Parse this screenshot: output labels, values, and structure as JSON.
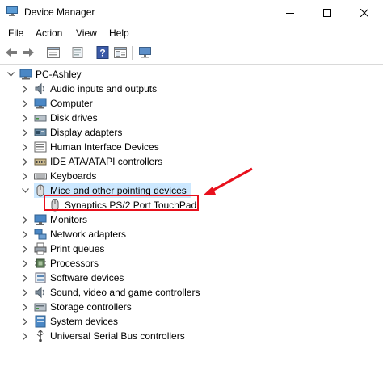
{
  "window": {
    "title": "Device Manager",
    "minimize_icon": "minimize-icon",
    "maximize_icon": "maximize-icon",
    "close_icon": "close-icon"
  },
  "menu": [
    "File",
    "Action",
    "View",
    "Help"
  ],
  "toolbar": {
    "buttons": [
      "back-arrow-icon",
      "forward-arrow-icon",
      "properties-icon",
      "update-driver-icon",
      "help-icon",
      "show-hidden-icon",
      "scan-hardware-icon"
    ]
  },
  "tree": {
    "root": "PC-Ashley",
    "categories": [
      "Audio inputs and outputs",
      "Computer",
      "Disk drives",
      "Display adapters",
      "Human Interface Devices",
      "IDE ATA/ATAPI controllers",
      "Keyboards",
      "Mice and other pointing devices",
      "Monitors",
      "Network adapters",
      "Print queues",
      "Processors",
      "Software devices",
      "Sound, video and game controllers",
      "Storage controllers",
      "System devices",
      "Universal Serial Bus controllers"
    ],
    "expanded_category": "Mice and other pointing devices",
    "child_device": "Synaptics PS/2 Port TouchPad"
  },
  "annotation": {
    "highlight_color": "#e8101c"
  }
}
